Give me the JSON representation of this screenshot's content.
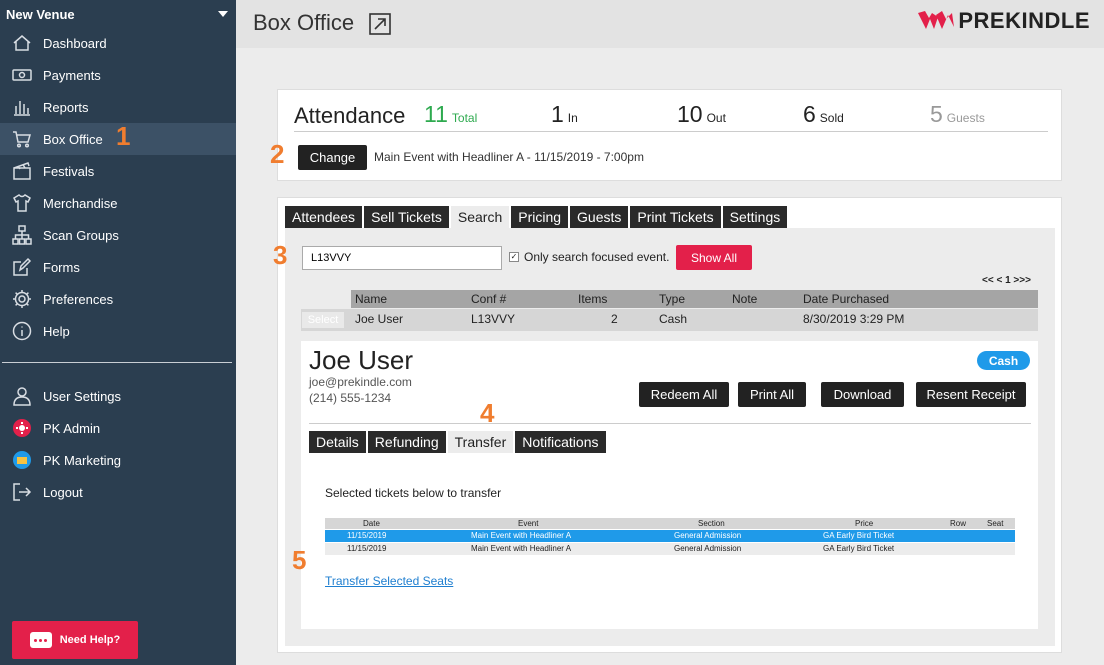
{
  "sidebar": {
    "venue": "New Venue",
    "items": [
      {
        "label": "Dashboard",
        "icon": "house-icon"
      },
      {
        "label": "Payments",
        "icon": "money-icon"
      },
      {
        "label": "Reports",
        "icon": "bar-chart-icon"
      },
      {
        "label": "Box Office",
        "icon": "cart-icon",
        "active": true
      },
      {
        "label": "Festivals",
        "icon": "film-icon"
      },
      {
        "label": "Merchandise",
        "icon": "shirt-icon"
      },
      {
        "label": "Scan Groups",
        "icon": "hierarchy-icon"
      },
      {
        "label": "Forms",
        "icon": "edit-icon"
      },
      {
        "label": "Preferences",
        "icon": "gear-icon"
      },
      {
        "label": "Help",
        "icon": "info-icon"
      }
    ],
    "account_items": [
      {
        "label": "User Settings",
        "icon": "user-icon"
      },
      {
        "label": "PK Admin",
        "icon": "admin-icon"
      },
      {
        "label": "PK Marketing",
        "icon": "marketing-icon"
      },
      {
        "label": "Logout",
        "icon": "logout-icon"
      }
    ],
    "need_help": "Need Help?"
  },
  "header": {
    "title": "Box Office",
    "logo": "PREKINDLE"
  },
  "attendance": {
    "title": "Attendance",
    "total": {
      "value": "11",
      "label": "Total"
    },
    "in": {
      "value": "1",
      "label": "In"
    },
    "out": {
      "value": "10",
      "label": "Out"
    },
    "sold": {
      "value": "6",
      "label": "Sold"
    },
    "guests": {
      "value": "5",
      "label": "Guests"
    },
    "change_label": "Change",
    "event": "Main Event with Headliner A - 11/15/2019 - 7:00pm"
  },
  "tabs": [
    "Attendees",
    "Sell Tickets",
    "Search",
    "Pricing",
    "Guests",
    "Print Tickets",
    "Settings"
  ],
  "search": {
    "value": "L13VVY",
    "checkbox_label": "Only search focused event.",
    "show_all": "Show All",
    "pager": "<< < 1 >>>"
  },
  "results": {
    "columns": [
      "Name",
      "Conf #",
      "Items",
      "Type",
      "Note",
      "Date Purchased"
    ],
    "row": {
      "select": "Select",
      "name": "Joe User",
      "conf": "L13VVY",
      "items": "2",
      "type": "Cash",
      "note": "",
      "date": "8/30/2019 3:29 PM"
    }
  },
  "customer": {
    "name": "Joe User",
    "email": "joe@prekindle.com",
    "phone": "(214) 555-1234",
    "badge": "Cash",
    "actions": [
      "Redeem All",
      "Print All",
      "Download",
      "Resent Receipt"
    ],
    "tabs": [
      "Details",
      "Refunding",
      "Transfer",
      "Notifications"
    ],
    "transfer_note": "Selected tickets below to transfer",
    "ticket_columns": [
      "Date",
      "Event",
      "Section",
      "Price",
      "Row",
      "Seat"
    ],
    "tickets": [
      {
        "date": "11/15/2019",
        "event": "Main Event with Headliner A",
        "section": "General Admission",
        "price": "GA Early Bird Ticket",
        "row": "",
        "seat": ""
      },
      {
        "date": "11/15/2019",
        "event": "Main Event with Headliner A",
        "section": "General Admission",
        "price": "GA Early Bird Ticket",
        "row": "",
        "seat": ""
      }
    ],
    "transfer_link": "Transfer Selected Seats"
  },
  "markers": [
    "1",
    "2",
    "3",
    "4",
    "5"
  ],
  "colors": {
    "sidebar": "#2b3e50",
    "accent": "#e3204a",
    "green": "#2eaa4f",
    "blue": "#1f9ae9",
    "orange": "#f07d2f"
  }
}
